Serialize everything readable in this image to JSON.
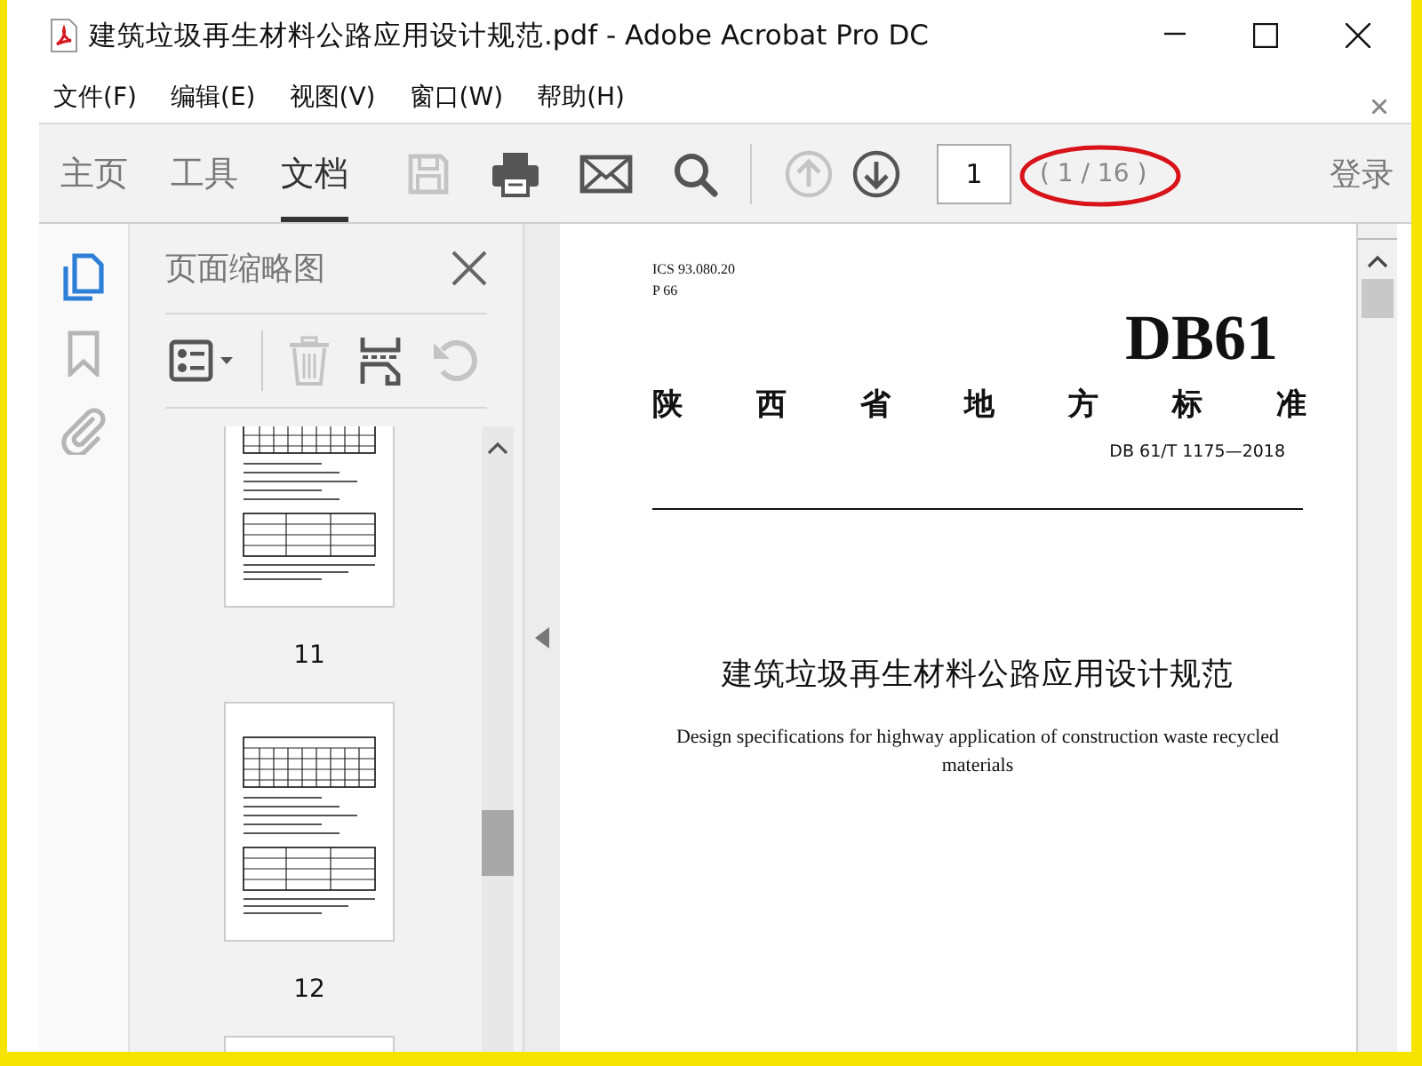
{
  "window": {
    "title": "建筑垃圾再生材料公路应用设计规范.pdf - Adobe Acrobat Pro DC"
  },
  "menu": [
    "文件(F)",
    "编辑(E)",
    "视图(V)",
    "窗口(W)",
    "帮助(H)"
  ],
  "toolbar": {
    "tabs": [
      {
        "label": "主页",
        "selected": false
      },
      {
        "label": "工具",
        "selected": false
      },
      {
        "label": "文档",
        "selected": true
      }
    ],
    "tools": [
      {
        "kind": "save",
        "disabled": true
      },
      {
        "kind": "print",
        "disabled": false
      },
      {
        "kind": "mail",
        "disabled": false
      },
      {
        "kind": "search",
        "disabled": false
      }
    ],
    "nav": [
      {
        "kind": "up",
        "disabled": true
      },
      {
        "kind": "down",
        "disabled": false
      }
    ],
    "page_input": {
      "value": "1"
    },
    "page_count": "( 1 / 16 )",
    "sign_in": "登录"
  },
  "side_rail": [
    {
      "kind": "pages",
      "selected": true
    },
    {
      "kind": "bookmarks",
      "selected": false
    },
    {
      "kind": "attachments",
      "selected": false
    }
  ],
  "thumbnail_panel": {
    "title": "页面缩略图",
    "tools": [
      {
        "kind": "options",
        "disabled": false
      },
      {
        "kind": "delete",
        "disabled": true
      },
      {
        "kind": "extract",
        "disabled": false
      },
      {
        "kind": "undo",
        "disabled": true
      }
    ],
    "thumbnails": [
      {
        "label": "11"
      },
      {
        "label": "12"
      }
    ],
    "more_below": true
  },
  "document": {
    "ics": "ICS 93.080.20",
    "class_code": "P 66",
    "code_mark": "DB61",
    "authority": "陕 西 省 地 方 标 准",
    "standard_number": "DB 61/T 1175—2018",
    "title_cn": "建筑垃圾再生材料公路应用设计规范",
    "title_en": "Design specifications for highway application of construction waste recycled materials"
  }
}
